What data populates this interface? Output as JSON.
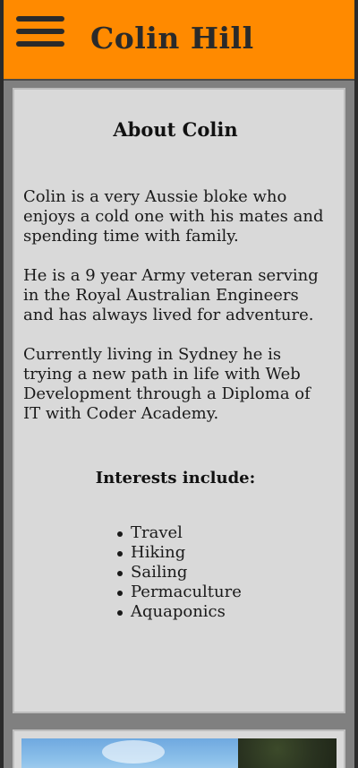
{
  "header": {
    "title": "Colin Hill",
    "menu_icon": "hamburger-menu-icon",
    "background_color": "#ff8a00"
  },
  "about": {
    "heading": "About Colin",
    "paragraphs": [
      "Colin is a very Aussie bloke who enjoys a cold one with his mates and spending time with family.",
      "He is a 9 year Army veteran serving in the Royal Australian Engineers and has always lived for adventure.",
      "Currently living in Sydney he is trying a new path in life with Web Development through a Diploma of IT with Coder Academy."
    ],
    "interests_heading": "Interests include:",
    "interests": [
      "Travel",
      "Hiking",
      "Sailing",
      "Permaculture",
      "Aquaponics"
    ]
  }
}
